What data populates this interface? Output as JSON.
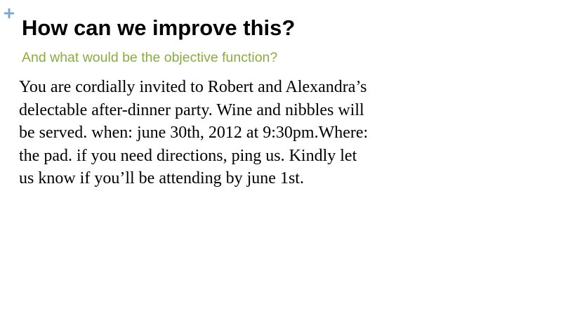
{
  "slide": {
    "title": "How can we improve this?",
    "subtitle": "And what would be the objective function?",
    "body_lines": [
      "You are cordially invited to Robert and Alexandra’s",
      "delectable after-dinner party. Wine and nibbles will",
      "be served. when: june 30th, 2012 at 9:30pm.Where:",
      "the pad. if you need directions, ping us. Kindly let",
      "us know if you’ll be attending by june 1st."
    ]
  },
  "decor": {
    "plus_icon": "plus-icon",
    "plus_color": "#7ea7d1"
  },
  "colors": {
    "title": "#000000",
    "subtitle": "#8aac3f",
    "body": "#000000"
  }
}
